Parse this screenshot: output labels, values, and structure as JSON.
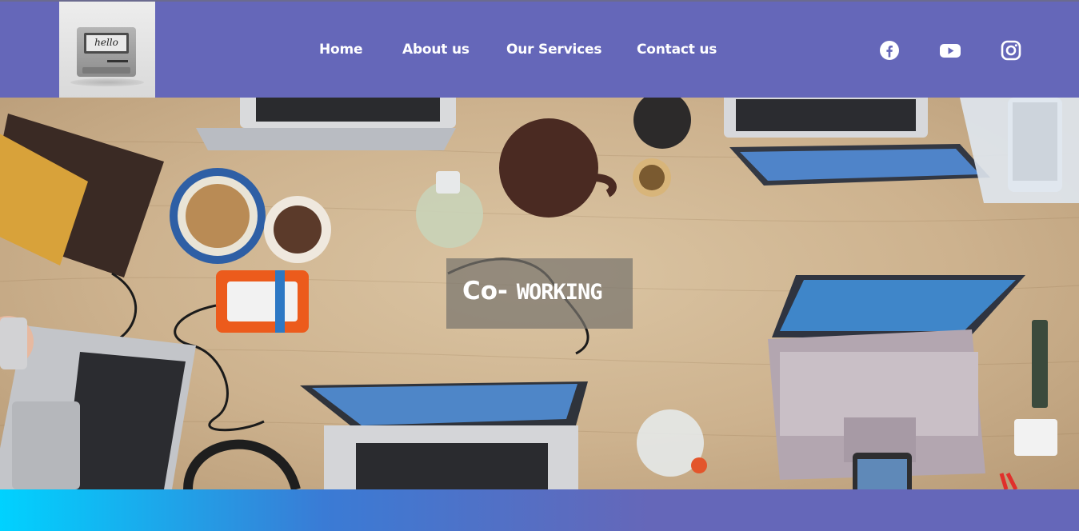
{
  "colors": {
    "navbar": "#6567b9",
    "nav_text": "#ffffff",
    "hero_overlay": "rgba(120,116,110,0.72)",
    "band_start": "#00d2ff",
    "band_end": "#6567b9"
  },
  "logo": {
    "text": "hello",
    "icon": "vintage-computer-logo"
  },
  "nav": {
    "links": [
      {
        "label": "Home"
      },
      {
        "label": "About us"
      },
      {
        "label": "Our Services"
      },
      {
        "label": "Contact us"
      }
    ]
  },
  "social": [
    {
      "name": "facebook",
      "icon": "facebook-icon"
    },
    {
      "name": "youtube",
      "icon": "youtube-icon"
    },
    {
      "name": "instagram",
      "icon": "instagram-icon"
    }
  ],
  "hero": {
    "title_prefix": "Co-",
    "title_accent": "WORKING",
    "image_subject": "coworking-desk-with-laptops"
  }
}
